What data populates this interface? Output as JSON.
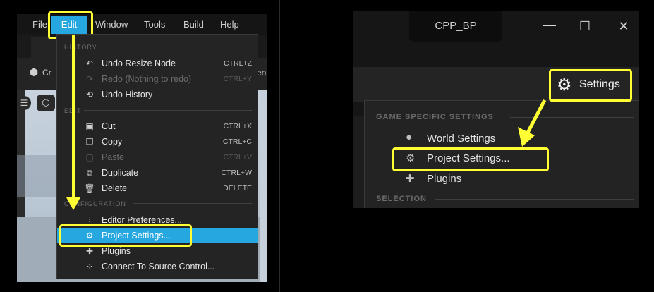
{
  "left": {
    "menubar": {
      "file": "File",
      "edit": "Edit",
      "window": "Window",
      "tools": "Tools",
      "build": "Build",
      "help": "Help"
    },
    "toolbar_frag_left": "Cr",
    "toolbar_frag_right": "en",
    "edit_menu": {
      "sections": {
        "history": "HISTORY",
        "edit": "EDIT",
        "configuration": "CONFIGURATION"
      },
      "items": [
        {
          "label": "Undo Resize Node",
          "shortcut": "CTRL+Z",
          "icon": "undo-icon"
        },
        {
          "label": "Redo (Nothing to redo)",
          "shortcut": "CTRL+Y",
          "icon": "redo-icon"
        },
        {
          "label": "Undo History",
          "shortcut": "",
          "icon": "history-icon"
        },
        {
          "label": "Cut",
          "shortcut": "CTRL+X",
          "icon": "cut-icon"
        },
        {
          "label": "Copy",
          "shortcut": "CTRL+C",
          "icon": "copy-icon"
        },
        {
          "label": "Paste",
          "shortcut": "CTRL+V",
          "icon": "paste-icon"
        },
        {
          "label": "Duplicate",
          "shortcut": "CTRL+W",
          "icon": "duplicate-icon"
        },
        {
          "label": "Delete",
          "shortcut": "DELETE",
          "icon": "trash-icon"
        },
        {
          "label": "Editor Preferences...",
          "shortcut": "",
          "icon": "sliders-icon"
        },
        {
          "label": "Project Settings...",
          "shortcut": "",
          "icon": "project-settings-icon"
        },
        {
          "label": "Plugins",
          "shortcut": "",
          "icon": "plugin-icon"
        },
        {
          "label": "Connect To Source Control...",
          "shortcut": "",
          "icon": "source-control-icon"
        }
      ]
    }
  },
  "right": {
    "tab_title": "CPP_BP",
    "settings_label": "Settings",
    "menu": {
      "section_game": "GAME SPECIFIC SETTINGS",
      "world_settings": "World Settings",
      "project_settings": "Project Settings...",
      "plugins": "Plugins",
      "section_selection": "SELECTION"
    }
  },
  "colors": {
    "highlight": "#ffff33",
    "accent": "#26a7e0"
  }
}
